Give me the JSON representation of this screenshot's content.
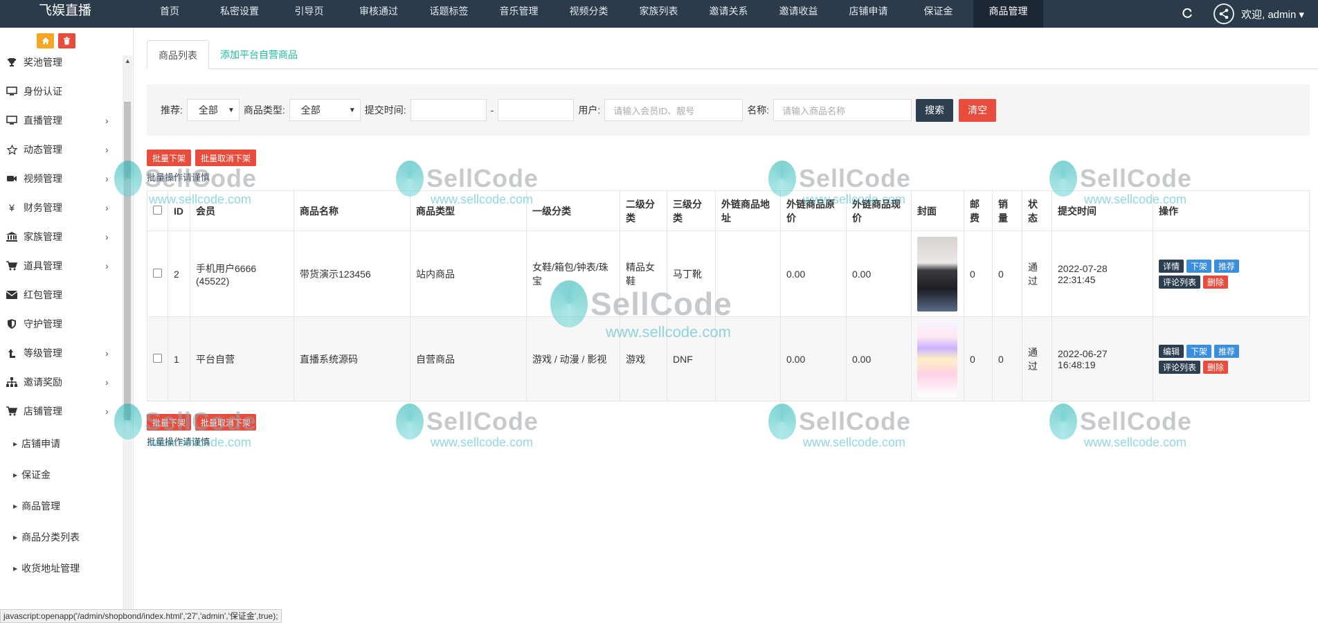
{
  "brand": "飞娱直播",
  "nav": [
    {
      "label": "首页",
      "w": 0
    },
    {
      "label": "私密设置"
    },
    {
      "label": "引导页"
    },
    {
      "label": "审核通过"
    },
    {
      "label": "话题标签"
    },
    {
      "label": "音乐管理"
    },
    {
      "label": "视频分类"
    },
    {
      "label": "家族列表"
    },
    {
      "label": "邀请关系"
    },
    {
      "label": "邀请收益"
    },
    {
      "label": "店铺申请"
    },
    {
      "label": "保证金"
    },
    {
      "label": "商品管理"
    }
  ],
  "user": {
    "welcome": "欢迎, admin ▾"
  },
  "sidebar": {
    "items": [
      {
        "label": "奖池管理",
        "icon": "trophy-icon"
      },
      {
        "label": "身份认证",
        "icon": "monitor-icon"
      },
      {
        "label": "直播管理",
        "icon": "monitor-icon"
      },
      {
        "label": "动态管理",
        "icon": "star-icon"
      },
      {
        "label": "视频管理",
        "icon": "video-icon"
      },
      {
        "label": "财务管理",
        "icon": "yen-icon"
      },
      {
        "label": "家族管理",
        "icon": "bank-icon"
      },
      {
        "label": "道具管理",
        "icon": "cart-icon"
      },
      {
        "label": "红包管理",
        "icon": "envelope-icon"
      },
      {
        "label": "守护管理",
        "icon": "shield-icon"
      },
      {
        "label": "等级管理",
        "icon": "level-icon"
      },
      {
        "label": "邀请奖励",
        "icon": "sitemap-icon"
      },
      {
        "label": "店铺管理",
        "icon": "cart-icon"
      }
    ],
    "sub_items": [
      "店铺申请",
      "保证金",
      "商品管理",
      "商品分类列表",
      "收货地址管理"
    ]
  },
  "tabs": {
    "list": "商品列表",
    "add": "添加平台自营商品"
  },
  "filters": {
    "recommend_label": "推荐:",
    "recommend_value": "全部",
    "type_label": "商品类型:",
    "type_value": "全部",
    "time_label": "提交时间:",
    "dash": "-",
    "user_label": "用户:",
    "user_placeholder": "请输入会员ID、靓号",
    "name_label": "名称:",
    "name_placeholder": "请输入商品名称",
    "search": "搜索",
    "clear": "清空"
  },
  "batch": {
    "off_shelf": "批量下架",
    "cancel_off_shelf": "批量取消下架",
    "note": "批量操作请谨慎"
  },
  "table": {
    "headers": [
      "ID",
      "会员",
      "商品名称",
      "商品类型",
      "一级分类",
      "二级分类",
      "三级分类",
      "外链商品地址",
      "外链商品原价",
      "外链商品现价",
      "封面",
      "邮费",
      "销量",
      "状态",
      "提交时间",
      "操作"
    ],
    "rows": [
      {
        "id": "2",
        "member": "手机用户6666 (45522)",
        "name": "带货演示123456",
        "type": "站内商品",
        "cat1": "女鞋/箱包/钟表/珠宝",
        "cat2": "精品女鞋",
        "cat3": "马丁靴",
        "link": "",
        "orig_price": "0.00",
        "now_price": "0.00",
        "postage": "0",
        "sales": "0",
        "status": "通过",
        "time": "2022-07-28 22:31:45",
        "ops": [
          "详情",
          "下架",
          "推荐",
          "评论列表",
          "删除"
        ]
      },
      {
        "id": "1",
        "member": "平台自营",
        "name": "直播系统源码",
        "type": "自营商品",
        "cat1": "游戏 / 动漫 / 影视",
        "cat2": "游戏",
        "cat3": "DNF",
        "link": "",
        "orig_price": "0.00",
        "now_price": "0.00",
        "postage": "0",
        "sales": "0",
        "status": "通过",
        "time": "2022-06-27 16:48:19",
        "ops": [
          "编辑",
          "下架",
          "推荐",
          "评论列表",
          "删除"
        ]
      }
    ]
  },
  "statusbar": "javascript:openapp('/admin/shopbond/index.html','27','admin','保证金',true);",
  "watermark": {
    "name": "SellCode",
    "url": "www.sellcode.com"
  }
}
